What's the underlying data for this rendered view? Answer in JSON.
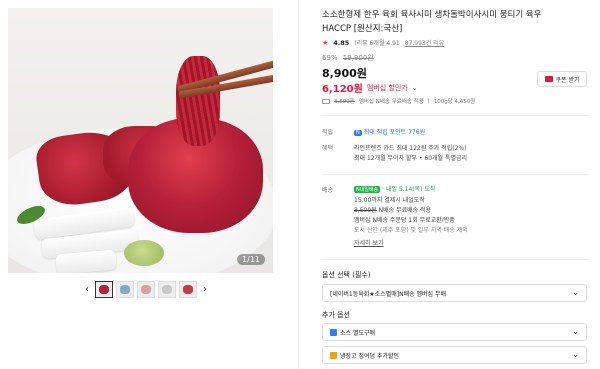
{
  "gallery": {
    "counter": "1/11",
    "prev_arrow": "‹",
    "next_arrow": "›",
    "thumbnail_count": 5
  },
  "product": {
    "title": "소소한형제 한우 육회 육사시미 생차돌박이사시미 뭉티기 육우 HACCP [원산지:국산]",
    "rating": "4.85",
    "rating_detail": "(리뷰 6개월 4.91",
    "review_count": "87,993건 리뷰",
    "discount_rate": "69%",
    "original_price": "19,900원",
    "price": "8,900원",
    "member_price": "6,120",
    "member_price_unit": "원",
    "member_label": "멤버십 할인가",
    "member_chev": "⌄",
    "coupon_button": "쿠폰 받기",
    "info_strike": "3,500원",
    "info_text": "멤버십 N배송 무료배송 적용",
    "info_sep": "|",
    "info_weight": "100g당 4,450원"
  },
  "details": {
    "point_label": "적립",
    "point_badge": "N",
    "point_text": "최대 적립 포인트 776원",
    "benefit_label": "혜택",
    "benefit_line1": "라인프렌즈 카드 최대 122원 추가 적립(2%)",
    "benefit_line2": "최대 12개월 무이자 할부 • 60개월 특별금리",
    "delivery_label": "배송",
    "delivery_badge": "N내일배송",
    "delivery_date": "· 내일 5.14(목) 도착",
    "delivery_line2": "15:00까지 결제시 내일도착",
    "delivery_strike": "3,500원",
    "delivery_line3": "N배송 무료배송 적용",
    "delivery_line4": "멤버십 N배송 주문당 1회 무료교환/반품",
    "delivery_line5": "도서 산간 (제주 포함) 및 일부 지역 배송 제외",
    "delivery_more": "자세히 보기"
  },
  "options": {
    "option_label": "옵션 선택 (필수)",
    "option_value": "[네이버1등육회★소스별매]N배송 멤버십 무배",
    "extra_label": "추가 옵션",
    "extra1_value": "소스 별도구매",
    "extra2_value": "냉장고 정여덤 추가할인",
    "chevron": "⌄"
  },
  "colors": {
    "accent_red": "#e5163e",
    "naver_green": "#1fb64a",
    "point_blue": "#2d7ef7"
  }
}
